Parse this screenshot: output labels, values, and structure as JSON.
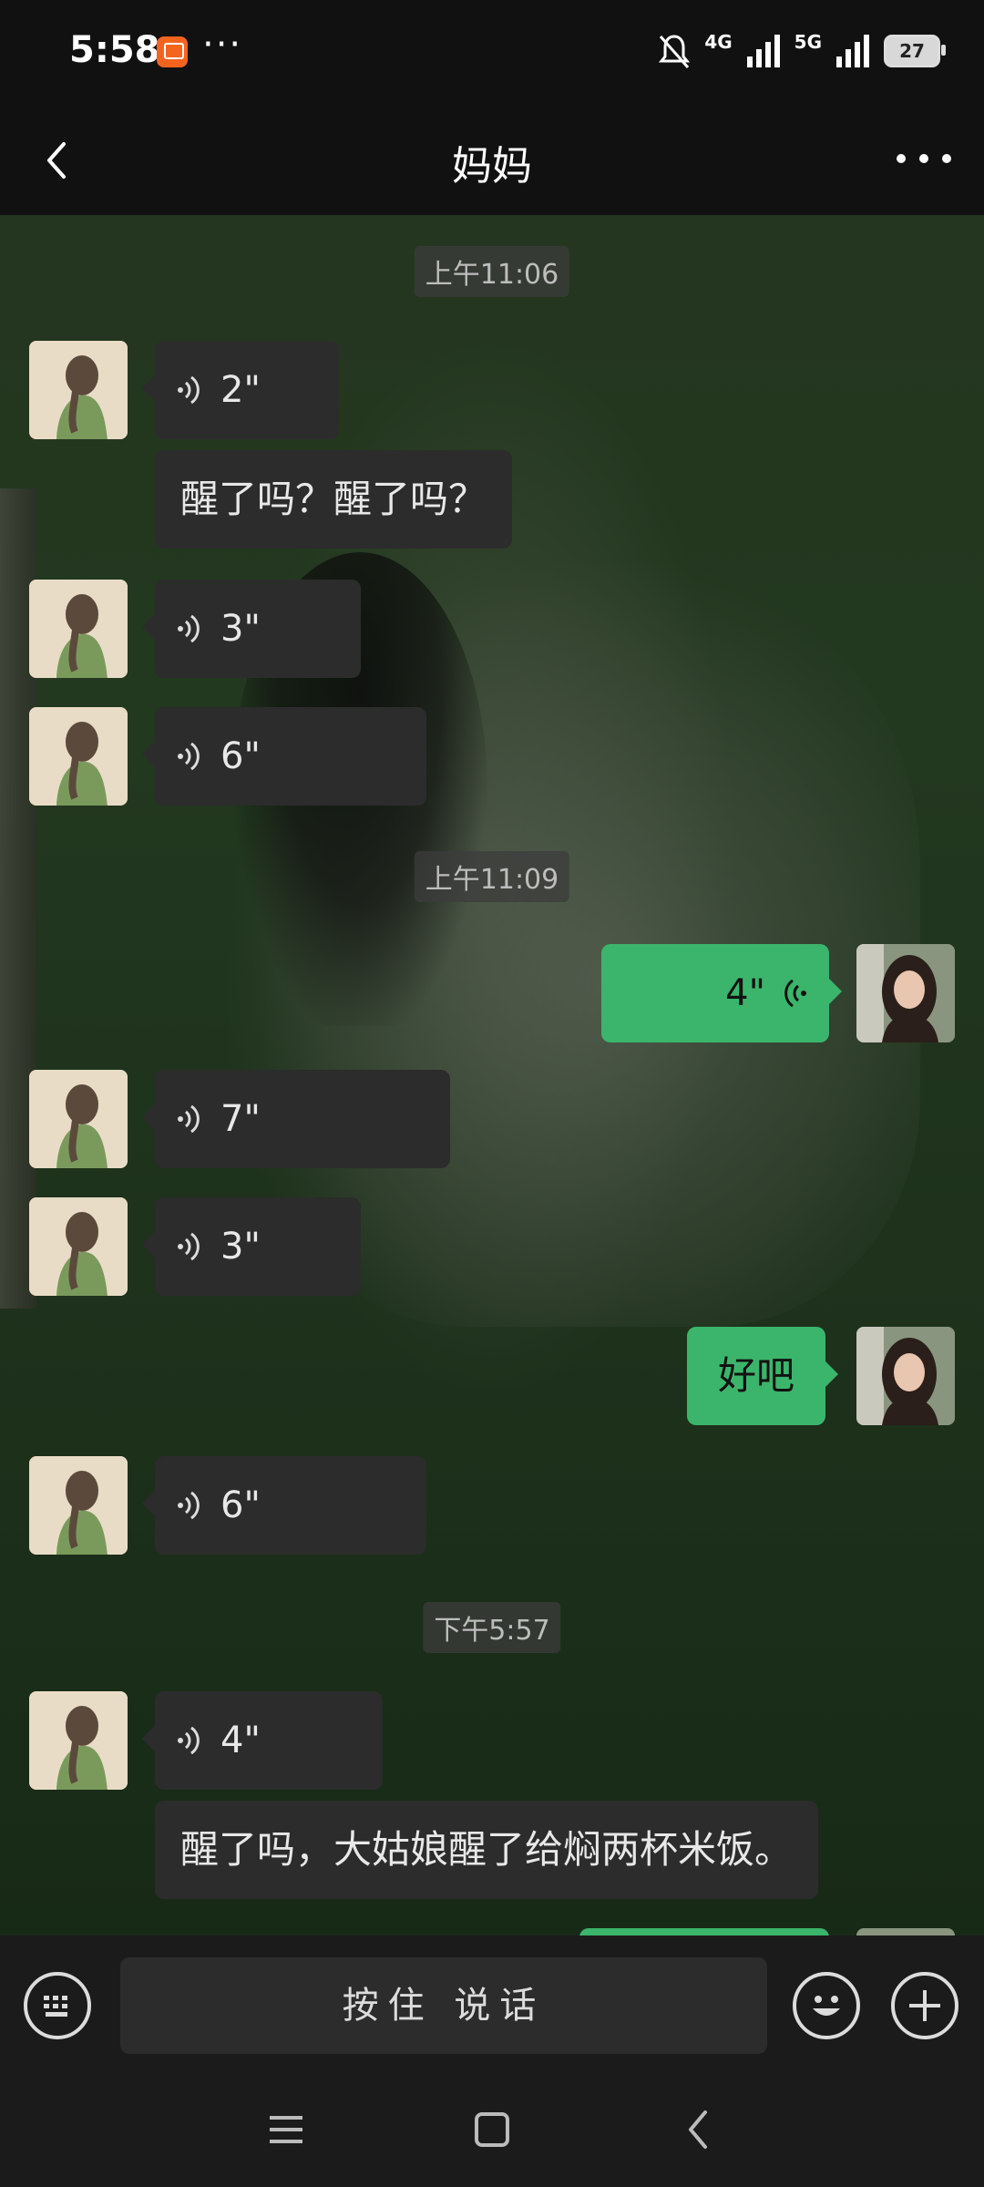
{
  "status": {
    "time": "5:58",
    "network_1": "4G",
    "network_2": "5G",
    "battery": "27"
  },
  "header": {
    "title": "妈妈"
  },
  "messages": [
    {
      "type": "time",
      "text": "上午11:06"
    },
    {
      "type": "voice",
      "side": "in",
      "duration": "2\""
    },
    {
      "type": "text",
      "side": "in",
      "text": "醒了吗？醒了吗？"
    },
    {
      "type": "voice",
      "side": "in",
      "duration": "3\""
    },
    {
      "type": "voice",
      "side": "in",
      "duration": "6\""
    },
    {
      "type": "time",
      "text": "上午11:09"
    },
    {
      "type": "voice",
      "side": "out",
      "duration": "4\""
    },
    {
      "type": "voice",
      "side": "in",
      "duration": "7\""
    },
    {
      "type": "voice",
      "side": "in",
      "duration": "3\""
    },
    {
      "type": "text",
      "side": "out",
      "text": "好吧"
    },
    {
      "type": "voice",
      "side": "in",
      "duration": "6\""
    },
    {
      "type": "time",
      "text": "下午5:57"
    },
    {
      "type": "voice",
      "side": "in",
      "duration": "4\""
    },
    {
      "type": "text",
      "side": "in",
      "text": "醒了吗，大姑娘醒了给焖两杯米饭。"
    }
  ],
  "input": {
    "hold_to_talk": "按住 说话"
  },
  "icons": {
    "keyboard": "keyboard-icon",
    "emoji": "emoji-icon",
    "plus": "plus-icon",
    "back": "back-arrow-icon",
    "more": "more-dots-icon"
  },
  "colors": {
    "outgoing_bubble": "#3bb56b",
    "incoming_bubble": "#2c2c2c",
    "bar_background": "#111111"
  }
}
